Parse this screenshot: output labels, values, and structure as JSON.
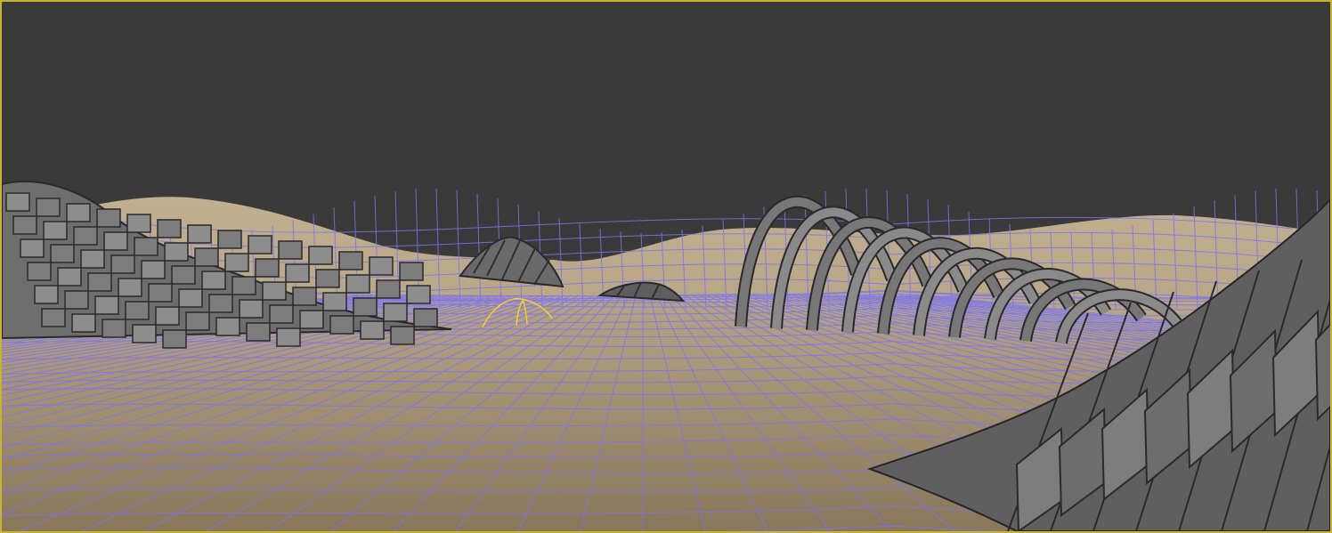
{
  "viewport": {
    "active": true,
    "border_color": "#c8b432",
    "background_color": "#3a3a3a"
  },
  "scene": {
    "terrain_color": "#b3a080",
    "terrain_dark_color": "#8f7c5f",
    "wireframe_color": "#7b74f0",
    "structure_color": "#7a7a7a",
    "structure_dark_color": "#4a4a4a",
    "gizmo_color": "#ffd21e"
  }
}
